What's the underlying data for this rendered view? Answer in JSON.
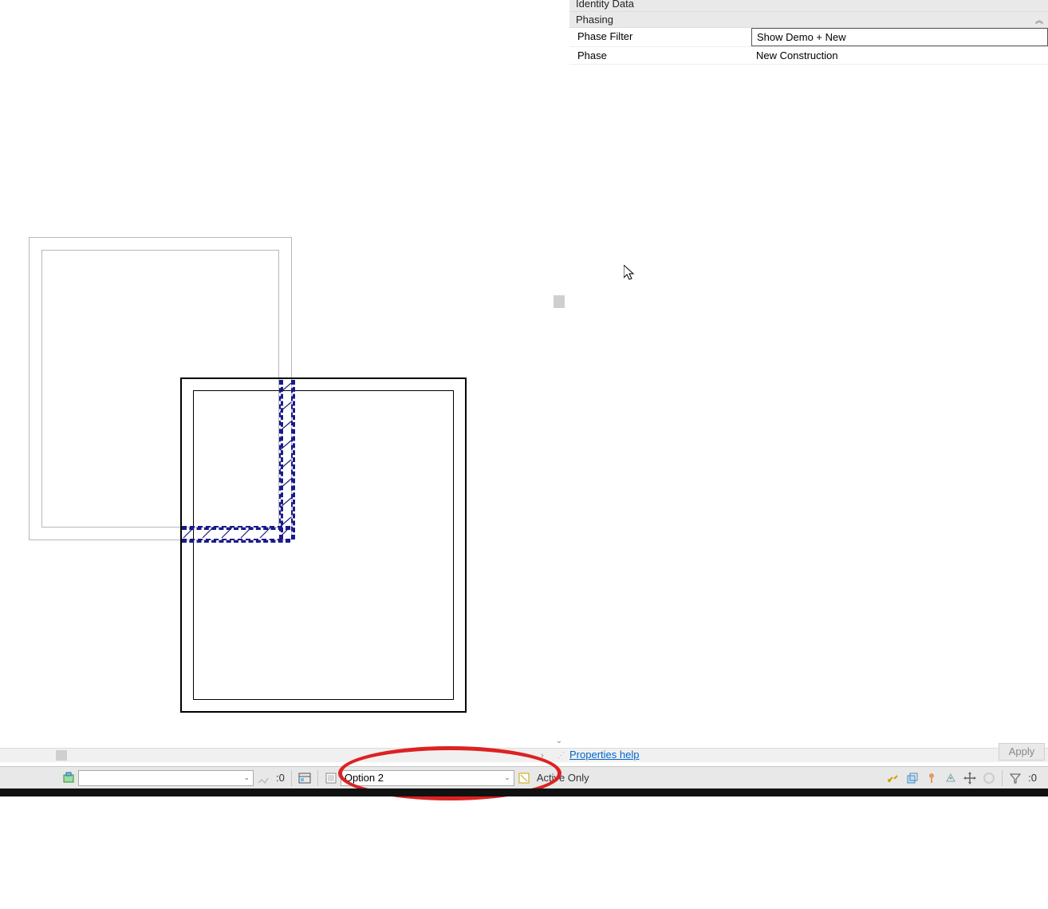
{
  "properties": {
    "section_prev": "Identity Data",
    "section": "Phasing",
    "rows": [
      {
        "label": "Phase Filter",
        "value": "Show Demo + New",
        "editable": true
      },
      {
        "label": "Phase",
        "value": "New Construction",
        "editable": false
      }
    ],
    "help_text": "Properties help",
    "apply_label": "Apply"
  },
  "statusbar": {
    "selection_count": ":0",
    "design_option_selected": "Option 2",
    "active_only_label": "Active Only",
    "filter_count": ":0"
  }
}
